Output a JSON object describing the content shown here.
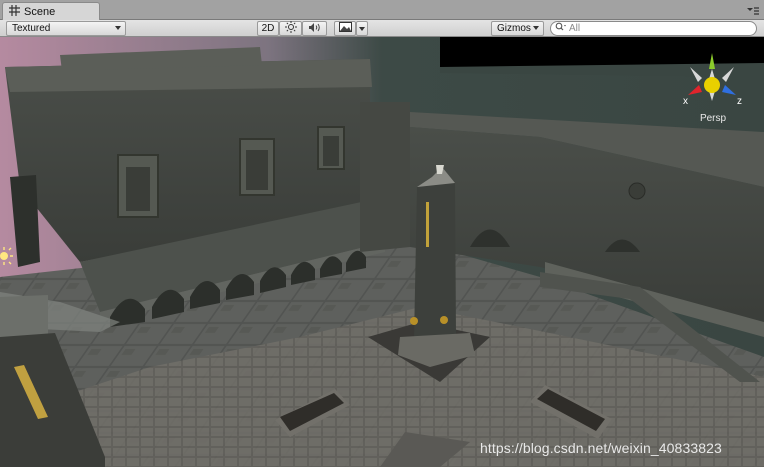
{
  "tab": {
    "title": "Scene",
    "icon": "grid-icon"
  },
  "toolbar": {
    "render_mode": "Textured",
    "mode_2d": "2D",
    "lighting_icon": "sun-icon",
    "audio_icon": "speaker-icon",
    "effects_icon": "image-icon",
    "gizmos": "Gizmos",
    "search_placeholder": "All"
  },
  "gizmo": {
    "x_label": "x",
    "z_label": "z",
    "projection": "Persp"
  },
  "watermark": "https://blog.csdn.net/weixin_40833823",
  "colors": {
    "axis_x": "#e0242c",
    "axis_y": "#8ccc2c",
    "axis_z": "#2f6fe0",
    "center": "#e8d000"
  }
}
